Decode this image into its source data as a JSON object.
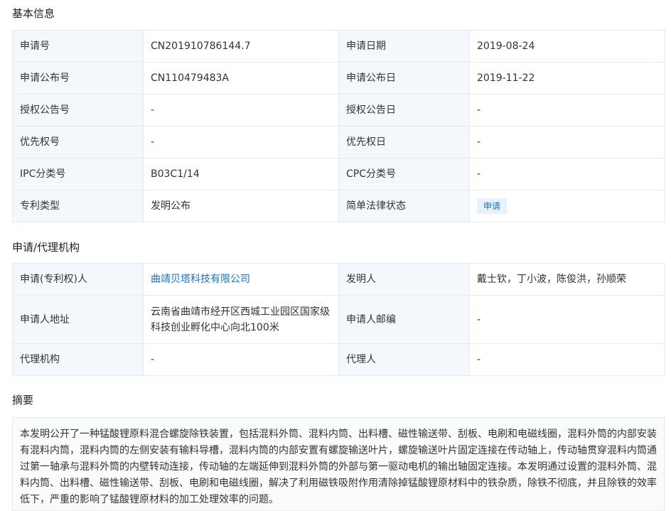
{
  "basic": {
    "title": "基本信息",
    "rows": [
      {
        "l1": "申请号",
        "v1": "CN201910786144.7",
        "l2": "申请日期",
        "v2": "2019-08-24"
      },
      {
        "l1": "申请公布号",
        "v1": "CN110479483A",
        "l2": "申请公布日",
        "v2": "2019-11-22"
      },
      {
        "l1": "授权公告号",
        "v1": "-",
        "l2": "授权公告日",
        "v2": "-"
      },
      {
        "l1": "优先权号",
        "v1": "-",
        "l2": "优先权日",
        "v2": "-"
      },
      {
        "l1": "IPC分类号",
        "v1": "B03C1/14",
        "l2": "CPC分类号",
        "v2": "-"
      },
      {
        "l1": "专利类型",
        "v1": "发明公布",
        "l2": "简单法律状态",
        "v2": "申请"
      }
    ]
  },
  "agency": {
    "title": "申请/代理机构",
    "rows": [
      {
        "l1": "申请(专利权)人",
        "v1": "曲靖贝塔科技有限公司",
        "l2": "发明人",
        "v2": "戴士钦，丁小波，陈俊洪，孙顺荣"
      },
      {
        "l1": "申请人地址",
        "v1": "云南省曲靖市经开区西城工业园区国家级科技创业孵化中心向北100米",
        "l2": "申请人邮编",
        "v2": "-"
      },
      {
        "l1": "代理机构",
        "v1": "-",
        "l2": "代理人",
        "v2": "-"
      }
    ]
  },
  "abstract": {
    "title": "摘要",
    "text": "本发明公开了一种锰酸锂原料混合螺旋除铁装置，包括混料外筒、混料内筒、出料槽、磁性输送带、刮板、电刷和电磁线圈，混料外筒的内部安装有混料内筒，混料内筒的左侧安装有输料导槽，混料内筒的内部安置有螺旋输送叶片，螺旋输送叶片固定连接在传动轴上，传动轴贯穿混料内筒通过第一轴承与混料外筒的内壁转动连接，传动轴的左端延伸到混料外筒的外部与第一驱动电机的输出轴固定连接。本发明通过设置的混料外筒、混料内筒、出料槽、磁性输送带、刮板、电刷和电磁线圈，解决了利用磁铁吸附作用清除掉锰酸锂原材料中的铁杂质，除铁不彻底，并且除铁的效率低下，严重的影响了锰酸锂原材料的加工处理效率的问题。"
  }
}
